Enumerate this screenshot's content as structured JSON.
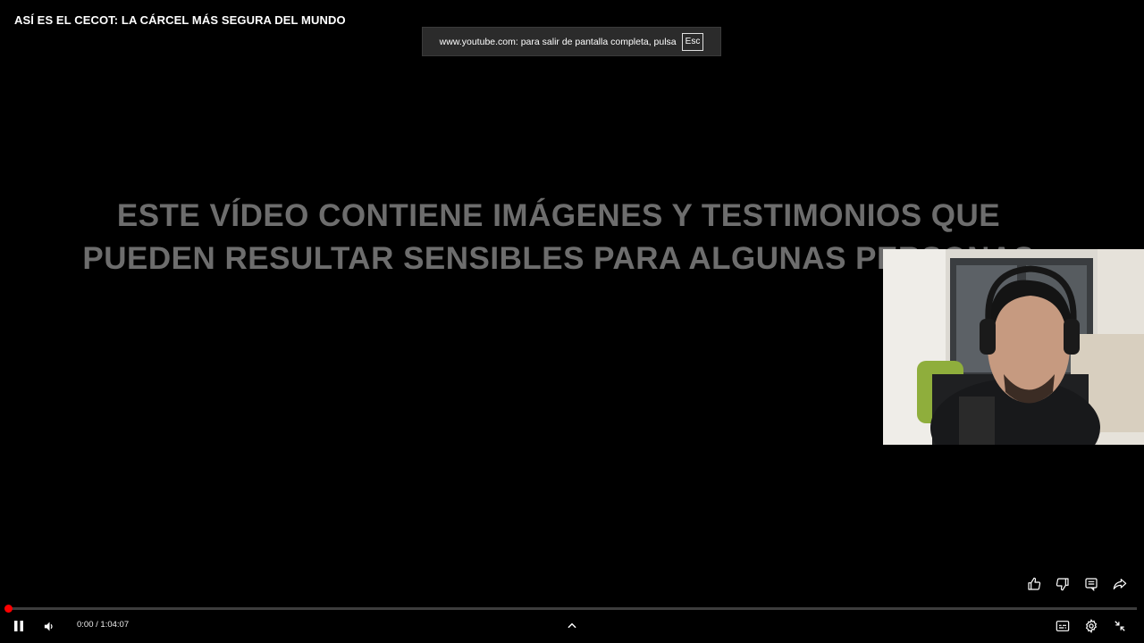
{
  "video": {
    "title": "ASÍ ES EL CECOT: LA CÁRCEL MÁS SEGURA DEL MUNDO",
    "warning_line1": "ESTE VÍDEO CONTIENE IMÁGENES Y TESTIMONIOS QUE",
    "warning_line2": "PUEDEN RESULTAR SENSIBLES PARA ALGUNAS PERSONAS"
  },
  "fullscreen_notice": {
    "text": "www.youtube.com: para salir de pantalla completa, pulsa",
    "key": "Esc"
  },
  "player": {
    "current_time": "0:00",
    "duration": "1:04:07",
    "time_display": "0:00 / 1:04:07",
    "progress_fraction": 0.0,
    "accent_color": "#ff0000"
  },
  "icons": {
    "like": "thumb-up-icon",
    "dislike": "thumb-down-icon",
    "comments": "comment-icon",
    "share": "share-icon",
    "pause": "pause-icon",
    "volume": "volume-icon",
    "expand": "chevron-up-icon",
    "subtitles": "subtitles-icon",
    "settings": "gear-icon",
    "exit_fullscreen": "exit-fullscreen-icon"
  }
}
